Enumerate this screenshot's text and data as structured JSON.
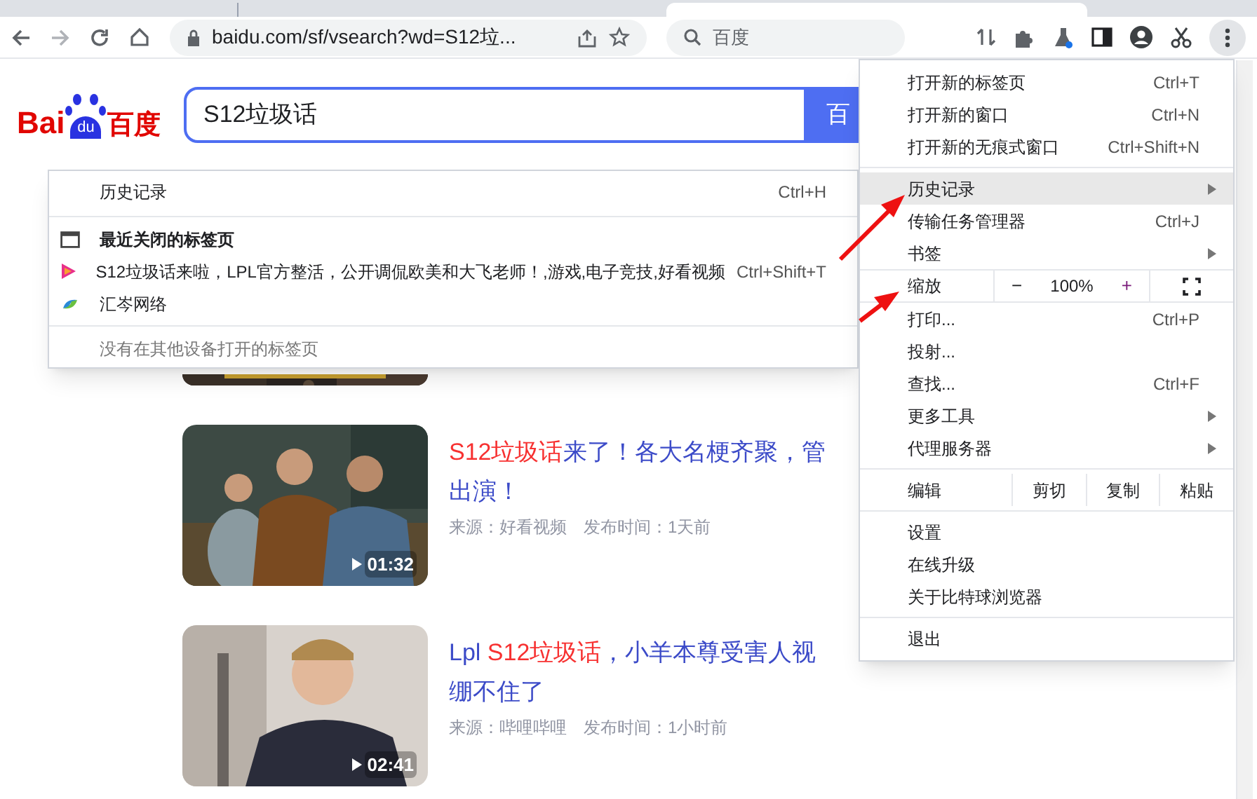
{
  "toolbar": {
    "address": "baidu.com/sf/vsearch?wd=S12垃...",
    "search_placeholder": "百度"
  },
  "logo": {
    "left": "Bai",
    "paw": "du",
    "right": "百度"
  },
  "search": {
    "value": "S12垃圾话",
    "button": "百"
  },
  "results": [
    {
      "duration": "01:32",
      "title_lines": [
        [
          {
            "text": "S12垃圾话",
            "highlight": true
          },
          {
            "text": "来了！各大名梗齐聚，管",
            "highlight": false
          }
        ],
        [
          {
            "text": "出演！",
            "highlight": false
          }
        ]
      ],
      "source": "来源：好看视频",
      "time": "发布时间：1天前"
    },
    {
      "duration": "02:41",
      "title_lines": [
        [
          {
            "text": "Lpl ",
            "highlight": false
          },
          {
            "text": "S12垃圾话",
            "highlight": true
          },
          {
            "text": "，小羊本尊受害人视",
            "highlight": false
          }
        ],
        [
          {
            "text": "绷不住了",
            "highlight": false
          }
        ]
      ],
      "source": "来源：哔哩哔哩",
      "time": "发布时间：1小时前"
    }
  ],
  "main_menu": [
    {
      "kind": "item",
      "label": "打开新的标签页",
      "shortcut": "Ctrl+T",
      "selected": false
    },
    {
      "kind": "item",
      "label": "打开新的窗口",
      "shortcut": "Ctrl+N",
      "selected": false
    },
    {
      "kind": "item",
      "label": "打开新的无痕式窗口",
      "shortcut": "Ctrl+Shift+N",
      "selected": false
    },
    {
      "kind": "separator"
    },
    {
      "kind": "submenu",
      "label": "历史记录",
      "selected": true
    },
    {
      "kind": "item",
      "label": "传输任务管理器",
      "shortcut": "Ctrl+J",
      "selected": false
    },
    {
      "kind": "submenu",
      "label": "书签",
      "selected": false
    },
    {
      "kind": "zoom",
      "label": "缩放",
      "minus": "−",
      "value": "100%",
      "plus": "+"
    },
    {
      "kind": "item",
      "label": "打印...",
      "shortcut": "Ctrl+P",
      "selected": false
    },
    {
      "kind": "item",
      "label": "投射...",
      "selected": false
    },
    {
      "kind": "item",
      "label": "查找...",
      "shortcut": "Ctrl+F",
      "selected": false
    },
    {
      "kind": "submenu",
      "label": "更多工具",
      "selected": false
    },
    {
      "kind": "submenu",
      "label": "代理服务器",
      "selected": false
    },
    {
      "kind": "separator"
    },
    {
      "kind": "edit",
      "label": "编辑",
      "buttons": [
        "剪切",
        "复制",
        "粘贴"
      ]
    },
    {
      "kind": "separator"
    },
    {
      "kind": "item",
      "label": "设置",
      "selected": false
    },
    {
      "kind": "item",
      "label": "在线升级",
      "selected": false
    },
    {
      "kind": "item",
      "label": "关于比特球浏览器",
      "selected": false
    },
    {
      "kind": "separator"
    },
    {
      "kind": "item",
      "label": "退出",
      "selected": false
    }
  ],
  "history_menu": [
    {
      "kind": "item",
      "label": "历史记录",
      "shortcut": "Ctrl+H"
    },
    {
      "kind": "separator"
    },
    {
      "kind": "heading",
      "label": "最近关闭的标签页"
    },
    {
      "kind": "video",
      "label": "S12垃圾话来啦，LPL官方整活，公开调侃欧美和大飞老师！,游戏,电子竞技,好看视频",
      "shortcut": "Ctrl+Shift+T"
    },
    {
      "kind": "site",
      "label": "汇岑网络"
    },
    {
      "kind": "separator"
    },
    {
      "kind": "note",
      "label": "没有在其他设备打开的标签页"
    }
  ]
}
